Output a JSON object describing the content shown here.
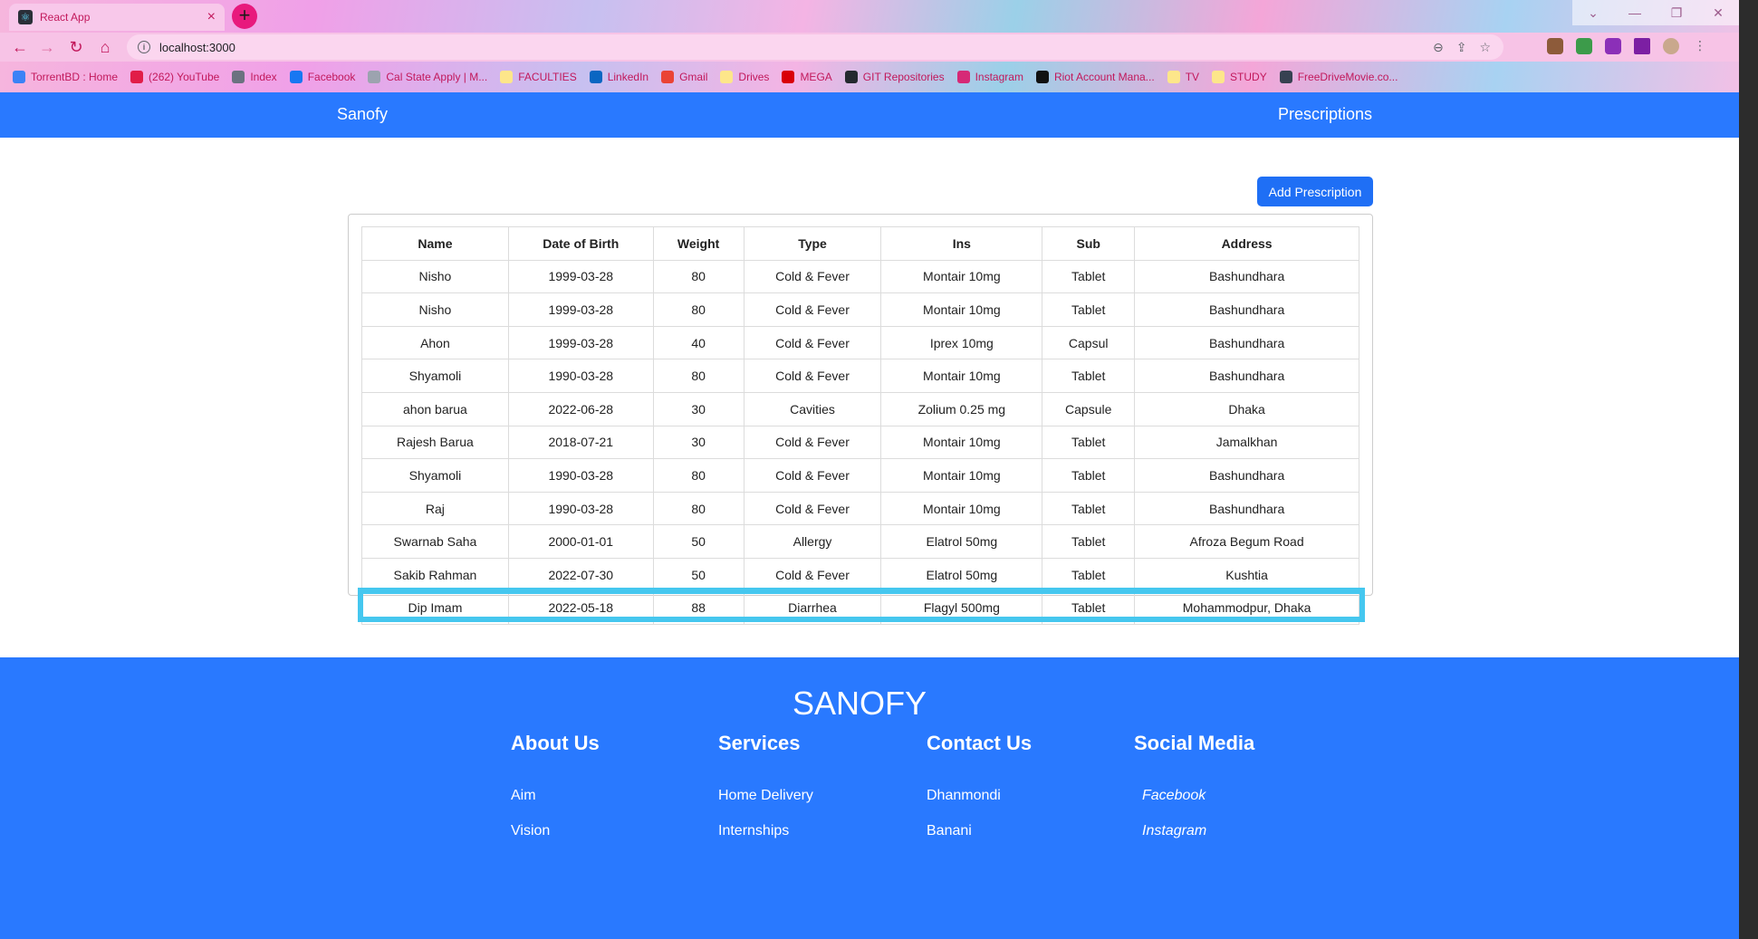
{
  "browser": {
    "tab_title": "React App",
    "url": "localhost:3000",
    "bookmarks": [
      {
        "label": "TorrentBD : Home",
        "color": "#3b82f6"
      },
      {
        "label": "(262) YouTube",
        "color": "#e11d48"
      },
      {
        "label": "Index",
        "color": "#6b7280"
      },
      {
        "label": "Facebook",
        "color": "#1877f2"
      },
      {
        "label": "Cal State Apply | M...",
        "color": "#9ca3af"
      },
      {
        "label": "FACULTIES",
        "color": "#fde68a"
      },
      {
        "label": "LinkedIn",
        "color": "#0a66c2"
      },
      {
        "label": "Gmail",
        "color": "#ea4335"
      },
      {
        "label": "Drives",
        "color": "#fde68a"
      },
      {
        "label": "MEGA",
        "color": "#d90007"
      },
      {
        "label": "GIT Repositories",
        "color": "#24292f"
      },
      {
        "label": "Instagram",
        "color": "#d62976"
      },
      {
        "label": "Riot Account Mana...",
        "color": "#111111"
      },
      {
        "label": "TV",
        "color": "#fde68a"
      },
      {
        "label": "STUDY",
        "color": "#fde68a"
      },
      {
        "label": "FreeDriveMovie.co...",
        "color": "#374151"
      }
    ]
  },
  "navbar": {
    "brand": "Sanofy",
    "link": "Prescriptions"
  },
  "main": {
    "add_button": "Add Prescription",
    "table": {
      "headers": [
        "Name",
        "Date of Birth",
        "Weight",
        "Type",
        "Ins",
        "Sub",
        "Address"
      ],
      "rows": [
        [
          "Nisho",
          "1999-03-28",
          "80",
          "Cold & Fever",
          "Montair 10mg",
          "Tablet",
          "Bashundhara"
        ],
        [
          "Nisho",
          "1999-03-28",
          "80",
          "Cold & Fever",
          "Montair 10mg",
          "Tablet",
          "Bashundhara"
        ],
        [
          "Ahon",
          "1999-03-28",
          "40",
          "Cold & Fever",
          "Iprex 10mg",
          "Capsul",
          "Bashundhara"
        ],
        [
          "Shyamoli",
          "1990-03-28",
          "80",
          "Cold & Fever",
          "Montair 10mg",
          "Tablet",
          "Bashundhara"
        ],
        [
          "ahon barua",
          "2022-06-28",
          "30",
          "Cavities",
          "Zolium 0.25 mg",
          "Capsule",
          "Dhaka"
        ],
        [
          "Rajesh Barua",
          "2018-07-21",
          "30",
          "Cold & Fever",
          "Montair 10mg",
          "Tablet",
          "Jamalkhan"
        ],
        [
          "Shyamoli",
          "1990-03-28",
          "80",
          "Cold & Fever",
          "Montair 10mg",
          "Tablet",
          "Bashundhara"
        ],
        [
          "Raj",
          "1990-03-28",
          "80",
          "Cold & Fever",
          "Montair 10mg",
          "Tablet",
          "Bashundhara"
        ],
        [
          "Swarnab Saha",
          "2000-01-01",
          "50",
          "Allergy",
          "Elatrol 50mg",
          "Tablet",
          "Afroza Begum Road"
        ],
        [
          "Sakib Rahman",
          "2022-07-30",
          "50",
          "Cold & Fever",
          "Elatrol 50mg",
          "Tablet",
          "Kushtia"
        ],
        [
          "Dip Imam",
          "2022-05-18",
          "88",
          "Diarrhea",
          "Flagyl 500mg",
          "Tablet",
          "Mohammodpur, Dhaka"
        ]
      ]
    }
  },
  "footer": {
    "title": "SANOFY",
    "columns": [
      {
        "heading": "About Us",
        "links": [
          "Aim",
          "Vision"
        ]
      },
      {
        "heading": "Services",
        "links": [
          "Home Delivery",
          "Internships"
        ]
      },
      {
        "heading": "Contact Us",
        "links": [
          "Dhanmondi",
          "Banani"
        ]
      },
      {
        "heading": "Social Media",
        "links": [
          "Facebook",
          "Instagram"
        ]
      }
    ]
  },
  "colors": {
    "primary": "#2979ff",
    "button": "#1f6ff5",
    "highlight": "#45c7ef"
  }
}
